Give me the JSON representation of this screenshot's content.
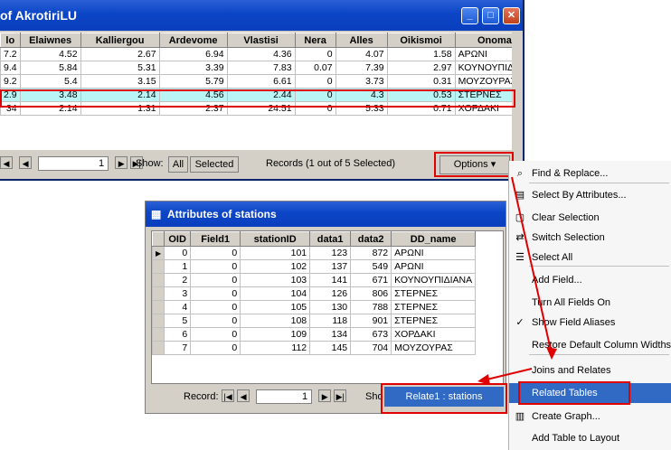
{
  "win1": {
    "title": "of AkrotiriLU",
    "columns": [
      "lo",
      "Elaiwnes",
      "Kalliergou",
      "Ardevome",
      "Vlastisi",
      "Nera",
      "Alles",
      "Oikismoi",
      "Onoma *"
    ],
    "rows": [
      [
        "7.2",
        "4.52",
        "2.67",
        "6.94",
        "4.36",
        "0",
        "4.07",
        "1.58",
        "ΑΡΩΝΙ"
      ],
      [
        "9.4",
        "5.84",
        "5.31",
        "3.39",
        "7.83",
        "0.07",
        "7.39",
        "2.97",
        "ΚΟΥΝΟΥΠΙΔΙΑΝΑ"
      ],
      [
        "9.2",
        "5.4",
        "3.15",
        "5.79",
        "6.61",
        "0",
        "3.73",
        "0.31",
        "ΜΟΥΖΟΥΡΑΣ"
      ],
      [
        "2.9",
        "3.48",
        "2.14",
        "4.56",
        "2.44",
        "0",
        "4.3",
        "0.53",
        "ΣΤΕΡΝΕΣ"
      ],
      [
        "34",
        "2.14",
        "1.31",
        "2.37",
        "24.51",
        "0",
        "5.33",
        "0.71",
        "ΧΟΡΔΑΚΙ"
      ]
    ],
    "selected_row": 3,
    "record_value": "1",
    "show_label": "Show:",
    "show_all": "All",
    "show_selected": "Selected",
    "records_text": "Records (1 out of 5 Selected)",
    "options_label": "Options"
  },
  "win2": {
    "title": "Attributes of stations",
    "columns": [
      "OID",
      "Field1",
      "stationID",
      "data1",
      "data2",
      "DD_name"
    ],
    "rows": [
      [
        "0",
        "0",
        "101",
        "123",
        "872",
        "ΑΡΩΝΙ"
      ],
      [
        "1",
        "0",
        "102",
        "137",
        "549",
        "ΑΡΩΝΙ"
      ],
      [
        "2",
        "0",
        "103",
        "141",
        "671",
        "ΚΟΥΝΟΥΠΙΔΙΑΝΑ"
      ],
      [
        "3",
        "0",
        "104",
        "126",
        "806",
        "ΣΤΕΡΝΕΣ"
      ],
      [
        "4",
        "0",
        "105",
        "130",
        "788",
        "ΣΤΕΡΝΕΣ"
      ],
      [
        "5",
        "0",
        "108",
        "118",
        "901",
        "ΣΤΕΡΝΕΣ"
      ],
      [
        "6",
        "0",
        "109",
        "134",
        "673",
        "ΧΟΡΔΑΚΙ"
      ],
      [
        "7",
        "0",
        "112",
        "145",
        "704",
        "ΜΟΥΖΟΥΡΑΣ"
      ]
    ],
    "record_label": "Record:",
    "record_value": "1",
    "show_partial": "Sho",
    "relate_item": "Relate1 : stations"
  },
  "menu": {
    "items": [
      {
        "label": "Find & Replace...",
        "icon": "binoculars-icon"
      },
      {
        "label": "Select By Attributes...",
        "icon": "sql-icon"
      },
      {
        "label": "Clear Selection",
        "icon": "clear-selection-icon"
      },
      {
        "label": "Switch Selection",
        "icon": "switch-selection-icon"
      },
      {
        "label": "Select All",
        "icon": "select-all-icon"
      },
      {
        "label": "Add Field...",
        "icon": ""
      },
      {
        "label": "Turn All Fields On",
        "icon": ""
      },
      {
        "label": "Show Field Aliases",
        "icon": "checkmark-icon"
      },
      {
        "label": "Restore Default Column Widths",
        "icon": ""
      },
      {
        "label": "Joins and Relates",
        "icon": ""
      },
      {
        "label": "Related Tables",
        "icon": ""
      },
      {
        "label": "Create Graph...",
        "icon": "graph-icon"
      },
      {
        "label": "Add Table to Layout",
        "icon": ""
      }
    ]
  },
  "colors": {
    "highlight": "#316ac5",
    "selected_row": "#b9f5f5",
    "annotation_red": "#e00000"
  }
}
